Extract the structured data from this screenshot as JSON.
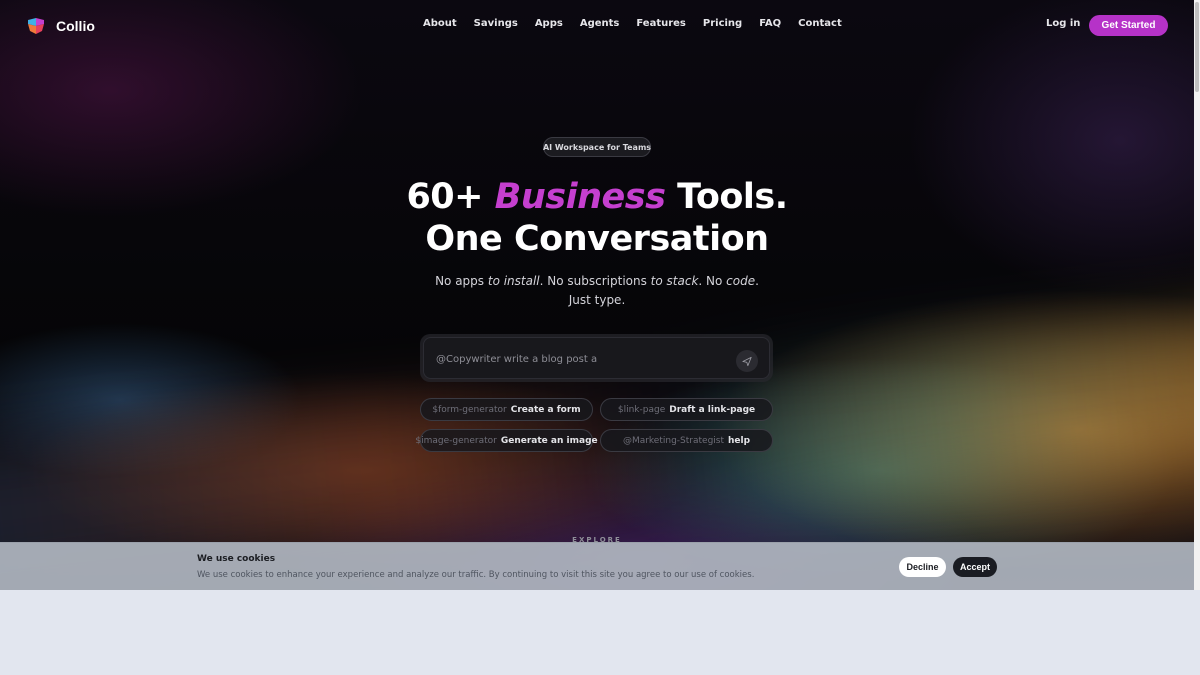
{
  "nav": {
    "brand": "Collio",
    "links": [
      "About",
      "Savings",
      "Apps",
      "Agents",
      "Features",
      "Pricing",
      "FAQ",
      "Contact"
    ],
    "login": "Log in",
    "cta": "Get Started"
  },
  "hero": {
    "badge": "AI Workspace for Teams",
    "headline_pre": "60+",
    "headline_accent": "Business",
    "headline_post": "Tools.",
    "headline_line2": "One Conversation",
    "sub": {
      "p1": "No apps ",
      "e1": "to install",
      "p2": ". No subscriptions ",
      "e2": "to stack",
      "p3": ". No ",
      "e3": "code",
      "p4": ".",
      "line2": "Just type."
    }
  },
  "prompt": {
    "placeholder": "@Copywriter write a blog post a",
    "send_icon": "send-icon"
  },
  "chips": [
    {
      "cmd": "$form-generator",
      "action": "Create a form"
    },
    {
      "cmd": "$link-page",
      "action": "Draft a link-page"
    },
    {
      "cmd": "$image-generator",
      "action": "Generate an image"
    },
    {
      "cmd": "@Marketing-Strategist",
      "action": "help"
    }
  ],
  "explore": "EXPLORE",
  "cookie": {
    "title": "We use cookies",
    "text": "We use cookies to enhance your experience and analyze our traffic. By continuing to visit this site you agree to our use of cookies.",
    "decline": "Decline",
    "accept": "Accept"
  },
  "colors": {
    "accent": "#c53fcf",
    "cta": "#b632c8",
    "background": "#07070a"
  }
}
